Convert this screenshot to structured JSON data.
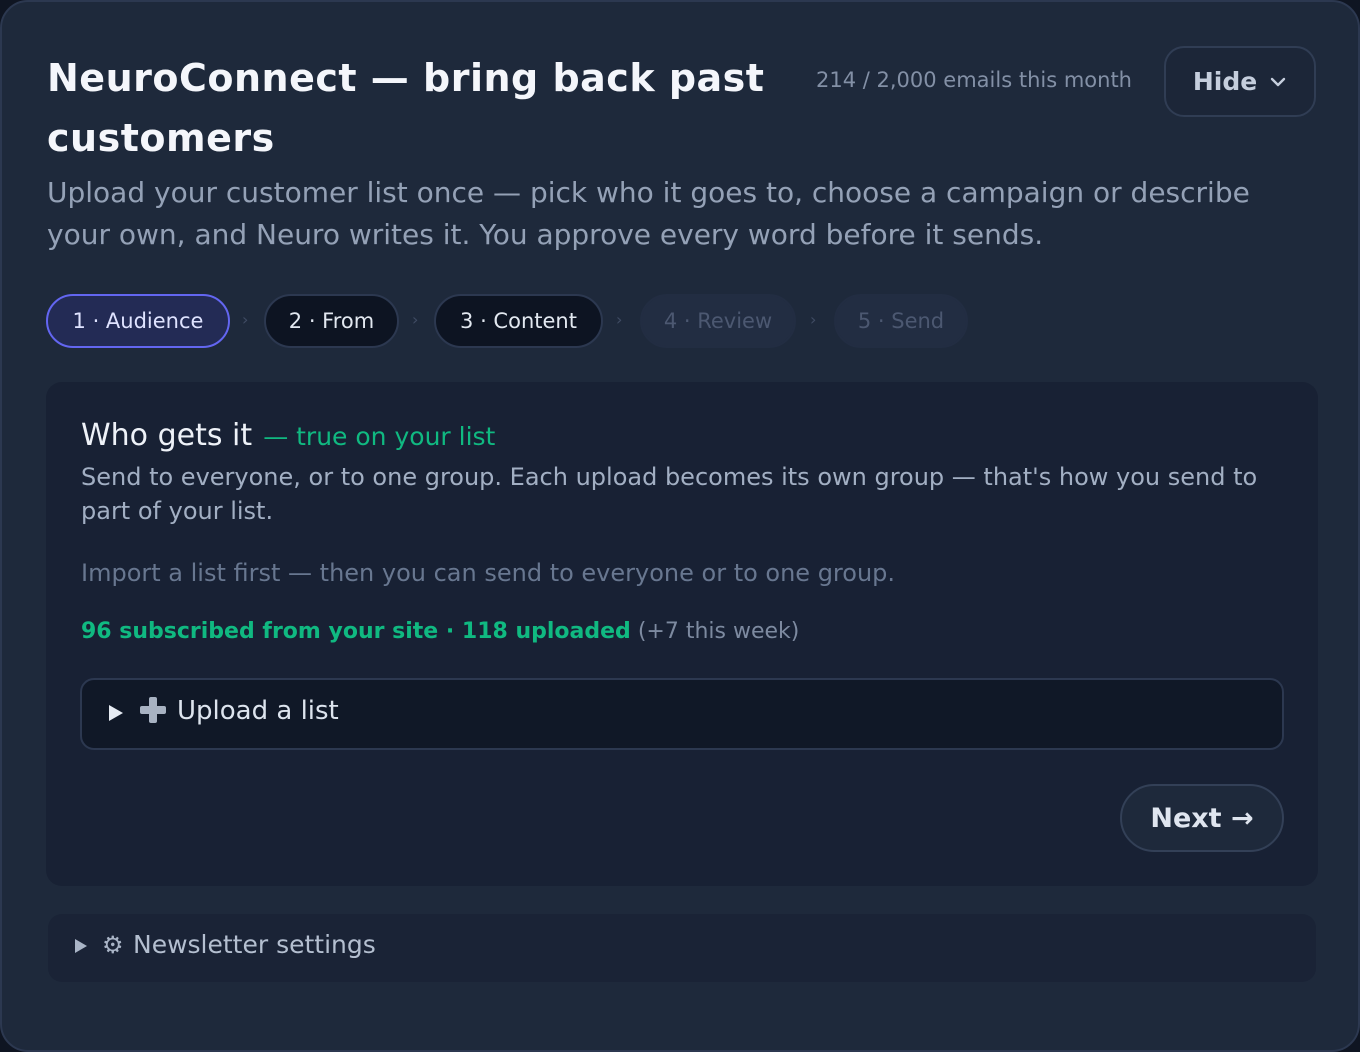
{
  "header": {
    "title": "NeuroConnect — bring back past customers",
    "usage": "214 / 2,000 emails this month",
    "hide_label": "Hide",
    "subtitle": "Upload your customer list once — pick who it goes to, choose a campaign or describe your own, and Neuro writes it. You approve every word before it sends."
  },
  "steps": [
    {
      "label": "1 · Audience",
      "state": "active"
    },
    {
      "label": "2 · From",
      "state": "done"
    },
    {
      "label": "3 · Content",
      "state": "done"
    },
    {
      "label": "4 · Review",
      "state": "disabled"
    },
    {
      "label": "5 · Send",
      "state": "disabled"
    }
  ],
  "step_separator": "›",
  "audience": {
    "title": "Who gets it",
    "note": "— true on your list",
    "description": "Send to everyone, or to one group. Each upload becomes its own group — that's how you send to part of your list.",
    "hint": "Import a list first — then you can send to everyone or to one group.",
    "stats_subscribed": "96 subscribed from your site",
    "stats_separator": " · ",
    "stats_uploaded": "118 uploaded",
    "stats_week": "(+7 this week)",
    "upload_label": "Upload a list",
    "next_label": "Next →"
  },
  "settings": {
    "label": "Newsletter settings"
  },
  "colors": {
    "accent": "#6366f1",
    "success": "#10b981",
    "background": "#1e293b"
  },
  "icons": {
    "hide": "chevron-down-icon",
    "upload_toggle": "triangle-right-icon",
    "upload": "plus-icon",
    "settings_toggle": "triangle-right-icon",
    "settings": "gear-icon"
  }
}
